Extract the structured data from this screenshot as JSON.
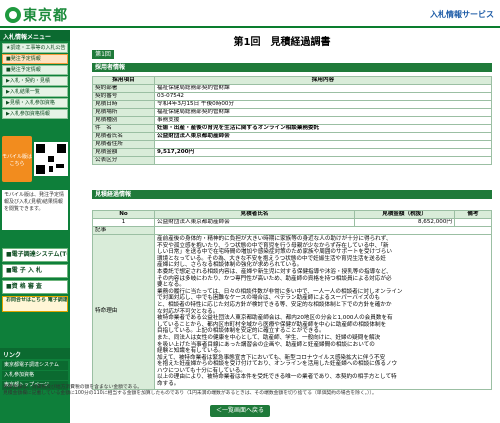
{
  "header": {
    "logo_text": "東京都",
    "system_link": "入札情報サービス"
  },
  "sidebar": {
    "heading": "入札情報メニュー",
    "items": [
      {
        "label": "★調達・工事等の入札公告",
        "hl": false
      },
      {
        "label": "■発注予定情報",
        "hl": true
      },
      {
        "label": "■発注予定情報",
        "hl": false
      },
      {
        "label": "▶入札・契約・見積",
        "hl": false
      },
      {
        "label": "▶入札結果一覧",
        "hl": false
      },
      {
        "label": "▶見積・入札参加資格",
        "hl": false
      },
      {
        "label": "▶入札参加資格情報",
        "hl": false
      }
    ],
    "mobile_label": "モバイル版はこちら",
    "mobile_note": "モバイル版は、発注予定情報及び入札(見積)結果情報を閲覧できます。",
    "links_heading": "リンク",
    "links": [
      "東京都電子調達システム",
      "入札参加資格",
      "東京都トップページ"
    ],
    "bottom_items": [
      {
        "label": "■電子調達システム(TOP)",
        "or": false
      },
      {
        "label": "■電 子 入 札",
        "or": false
      },
      {
        "label": "■資 格 審 査",
        "or": false
      },
      {
        "label": "お問合せはこちら 電子調達チャットボット",
        "or": true
      }
    ]
  },
  "page": {
    "title": "第1回　見積経過調書",
    "badge": "第1回"
  },
  "sections": {
    "applicant": "採用者情報",
    "quote": "見積経過情報"
  },
  "table1": {
    "col_item": "採用項目",
    "col_content": "採用内容",
    "rows": [
      {
        "label": "契約部署",
        "value": "福祉保健局総務部契約管財課"
      },
      {
        "label": "契約番号",
        "value": "03-07542"
      },
      {
        "label": "見積日時",
        "value": "令和4年3月15日 午後0時00分"
      },
      {
        "label": "見積場所",
        "value": "福祉保健局総務部契約管財課"
      },
      {
        "label": "見積種別",
        "value": "事務支援"
      },
      {
        "label": "件　名",
        "value": "妊娠・出産・産後の育児を生活に関するオンライン相談業務委託"
      },
      {
        "label": "見積者氏名",
        "value": "公益財団法人東京都助産師会"
      },
      {
        "label": "見積者住所",
        "value": ""
      },
      {
        "label": "見積金額",
        "value": "9,517,200円"
      },
      {
        "label": "公表区分",
        "value": ""
      }
    ]
  },
  "table2": {
    "headers": [
      "No",
      "見積者氏名",
      "見積金額（税抜）",
      "備考"
    ],
    "rows": [
      {
        "no": "1",
        "name": "公益財団法人東京都助産師会",
        "amount": "8,652,000円",
        "note": ""
      }
    ],
    "remark_label": "記事",
    "remark_value": "",
    "spec_label": "特命理由",
    "spec_lines": [
      "産前産後の身体的・精神的に負担が大きい時期に家族等の身近な人の助けが十分に得られず、",
      "不安や孤立感を抱いたり、うつ状態の中で育児を行う母親が少なからず存在している中、「新",
      "しい日常」を送る中で在宅時間の増加や感染症対策のため家族や周囲のサポートを受けづらい",
      "環境となっている。その為、大きな不安を抱えうつ状態の中で妊娠生活や育児生活を送る妊",
      "産婦に対し、さらなる相談体制の強化が求められている。",
      "本委託で想定される相談内容は、産婦や新生児に対する保健指導や沐浴・授乳等の指導など、",
      "その内容は多岐にわたり、かつ専門性が高いため、助産師の資格を持つ相談員による対応が必",
      "要となる。",
      "業務の履行に当たっては、日々の相談件数が非常に多い中で、一人一人の相談者に対しオンライン",
      "で対面対応し、中でも困難なケースの場合は、ペテラン助産師によるスーパーバイズのも",
      "と、相談者の特性に応じた対応方針が検討できる等、安定的な相談体制と下での方針を確かか",
      "な対応が不可欠となる。",
      "被特命業者である公益社団法人東京都助産師会は、都内20地区の分会と1,000人の会員数を有",
      "していることから、都内区市町村全域から医療や保健が助産師を中心に助産師の相談体制を",
      "目指している。上記の相談体制を安定的に確立することができる。",
      "また、同法人は女性の健康を中心として、助産師、学生、一般向けに、妊婦の疑問を解決",
      "を吸い上げた当事者目線にあった講習会の企画や、助産師と妊産婦間の相談においての",
      "経験と知識を有している。",
      "加えて、被特命業者は緊急事態宣言下においても、新型コロナウイルス感染拡大に伴う不安",
      "を抱えた妊産婦からの相談を受け付けており、オンラインを活用した妊産婦への相談に係るノウ",
      "ハウについても十分に有している。",
      "以上の理由により、被特命業者は本件を受託できる唯一の業者であり、本契約の相手方として特",
      "命する。"
    ]
  },
  "footer": {
    "line1": "見積金額は、消費税及び地方消費税の額を含まない金額である。",
    "line2": "見積金額欄に記載している金額に100分の110に相当する金額を加算したものであり（1円未満の端数があるときは、その端数金額を切り捨てる（単価契約の場合を除く。））。",
    "back_label": "＜一覧画面へ戻る"
  }
}
